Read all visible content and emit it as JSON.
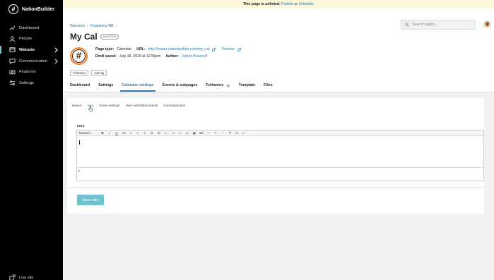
{
  "sidebar": {
    "brand": "NationBuilder",
    "live_site": "Live site",
    "items": [
      {
        "label": "Dashboard",
        "icon": "dashboard-icon"
      },
      {
        "label": "People",
        "icon": "people-icon"
      },
      {
        "label": "Website",
        "icon": "website-icon",
        "active": true,
        "chevron": true
      },
      {
        "label": "Communication",
        "icon": "communication-icon",
        "chevron": true
      },
      {
        "label": "Finances",
        "icon": "finances-icon"
      },
      {
        "label": "Settings",
        "icon": "settings-icon"
      }
    ]
  },
  "banner": {
    "text": "This page is unlisted.",
    "publish": "Publish",
    "or": "or",
    "schedule": "Schedule"
  },
  "breadcrumb": {
    "first": "Websites",
    "second": "Explaining NB"
  },
  "page": {
    "title": "My Cal",
    "status": "UNLISTED",
    "type_label": "Page type:",
    "type_value": "Calendar",
    "url_label": "URL:",
    "url_value": "http://howto.nationbuilder.com/my_cal",
    "preview": "Preview",
    "draft_label": "Draft saved:",
    "draft_value": "July 18, 2019 at 12:59pm",
    "author_label": "Author:",
    "author_value": "Jolynn Braswell",
    "tags": [
      "Following",
      "Add tag"
    ]
  },
  "search": {
    "placeholder": "Search pages..."
  },
  "tabs": [
    {
      "label": "Dashboard"
    },
    {
      "label": "Settings"
    },
    {
      "label": "Calendar settings",
      "active": true
    },
    {
      "label": "Events & subpages"
    },
    {
      "label": "Followers",
      "count": "0"
    },
    {
      "label": "Template"
    },
    {
      "label": "Files"
    }
  ],
  "subtabs": [
    {
      "label": "Basics"
    },
    {
      "label": "Intro",
      "active": true
    },
    {
      "label": "Event settings"
    },
    {
      "label": "User submitted events"
    },
    {
      "label": "Autoresponses"
    }
  ],
  "editor": {
    "label": "Intro",
    "format": "Normal",
    "status": "p"
  },
  "save_label": "Save intro",
  "colors": {
    "accent": "#2f7fa8",
    "button": "#6fc3d0",
    "banner": "#fdf6d8"
  }
}
